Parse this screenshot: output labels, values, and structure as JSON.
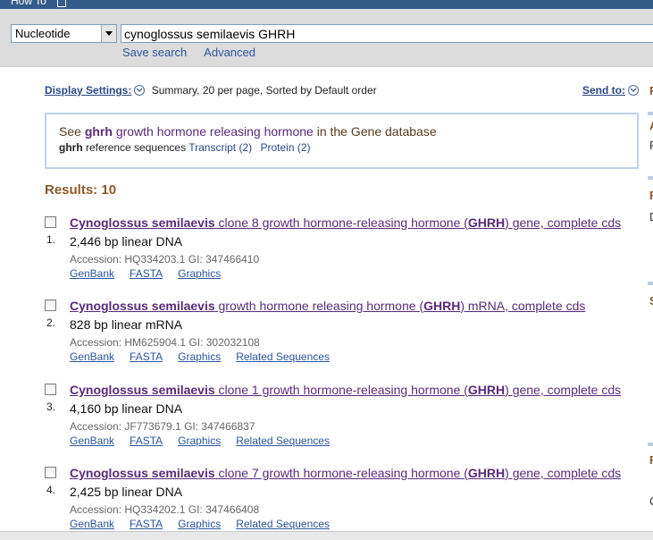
{
  "top": {
    "howto": "How To"
  },
  "search": {
    "database": "Nucleotide",
    "query": "cynoglossus semilaevis GHRH",
    "save_search": "Save search",
    "advanced": "Advanced"
  },
  "display": {
    "settings_label": "Display Settings:",
    "summary": "Summary, 20 per page, Sorted by Default order",
    "send_to": "Send to:"
  },
  "gene_box": {
    "see": "See",
    "gene_symbol": "ghrh",
    "gene_name": "growth hormone releasing hormone",
    "in_db": "in the Gene database",
    "ref_symbol": "ghrh",
    "ref_text": "reference sequences",
    "transcript_link": "Transcript (2)",
    "protein_link": "Protein (2)"
  },
  "results_header": "Results: 10",
  "results": [
    {
      "num": "1.",
      "species": "Cynoglossus semilaevis",
      "title_mid": " clone 8 growth hormone-releasing hormone (",
      "gene": "GHRH",
      "title_end": ") gene, complete cds",
      "desc": "2,446 bp linear DNA",
      "accession": "Accession: HQ334203.1   GI: 347466410",
      "links": [
        "GenBank",
        "FASTA",
        "Graphics"
      ]
    },
    {
      "num": "2.",
      "species": "Cynoglossus semilaevis",
      "title_mid": " growth hormone releasing hormone (",
      "gene": "GHRH",
      "title_end": ") mRNA, complete cds",
      "desc": "828 bp linear mRNA",
      "accession": "Accession: HM625904.1   GI: 302032108",
      "links": [
        "GenBank",
        "FASTA",
        "Graphics",
        "Related Sequences"
      ]
    },
    {
      "num": "3.",
      "species": "Cynoglossus semilaevis",
      "title_mid": " clone 1 growth hormone-releasing hormone (",
      "gene": "GHRH",
      "title_end": ") gene, complete cds",
      "desc": "4,160 bp linear DNA",
      "accession": "Accession: JF773679.1   GI: 347466837",
      "links": [
        "GenBank",
        "FASTA",
        "Graphics",
        "Related Sequences"
      ]
    },
    {
      "num": "4.",
      "species": "Cynoglossus semilaevis",
      "title_mid": " clone 7 growth hormone-releasing hormone (",
      "gene": "GHRH",
      "title_end": ") gene, complete cds",
      "desc": "2,425 bp linear DNA",
      "accession": "Accession: HQ334202.1   GI: 347466408",
      "links": [
        "GenBank",
        "FASTA",
        "Graphics",
        "Related Sequences"
      ]
    }
  ],
  "right_rail": [
    "F",
    "A",
    "F",
    "F",
    "D",
    "S",
    "F",
    "C"
  ],
  "colors": {
    "brand_bar": "#345c8a",
    "link": "#2a55a0",
    "visited": "#5a2a7a",
    "results_header": "#8b5a2b"
  }
}
